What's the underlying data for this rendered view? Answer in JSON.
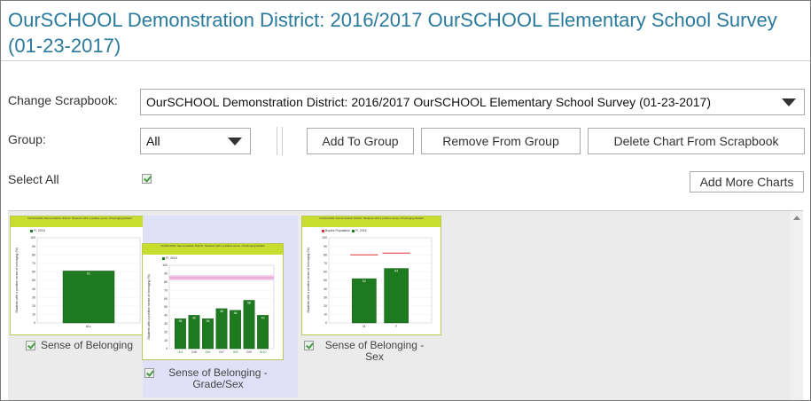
{
  "title": "OurSCHOOL Demonstration District: 2016/2017 OurSCHOOL Elementary School Survey (01-23-2017)",
  "scrapbook": {
    "label": "Change Scrapbook:",
    "selected": "OurSCHOOL Demonstration District: 2016/2017 OurSCHOOL Elementary School Survey (01-23-2017)"
  },
  "group": {
    "label": "Group:",
    "selected": "All",
    "add_label": "Add To Group",
    "remove_label": "Remove From Group",
    "delete_label": "Delete Chart From Scrapbook"
  },
  "select_all": {
    "label": "Select All",
    "checked": true
  },
  "add_more_label": "Add More Charts",
  "colors": {
    "title": "#2a7a9c",
    "bar": "#1e7a1e",
    "header": "#c9dd2f",
    "selected_bg": "#e0e0f8",
    "panel": "#ebebeb",
    "canada_line": "#e03030"
  },
  "charts": [
    {
      "label": "Sense of Belonging",
      "checked": true,
      "thumb_title": "OurSCHOOL Demonstration District: Students with a positive sense of belonging Default",
      "legend": [
        "Fi, 2016"
      ],
      "ylabel": "Students with a positive sense of belonging (%)",
      "yticks": [
        "100",
        "90",
        "80",
        "70",
        "60",
        "50",
        "40",
        "30",
        "20",
        "10",
        "0"
      ],
      "categories": [
        "ALL"
      ],
      "values": [
        61
      ],
      "value_labels": [
        "61"
      ],
      "ymax": 100
    },
    {
      "label": "Sense of Belonging - Grade/Sex",
      "checked": true,
      "selected": true,
      "thumb_title": "OurSCHOOL Demonstration District: Students with a positive sense of belonging Default",
      "legend": [
        "Fi, 2016"
      ],
      "ylabel": "Students with a positive sense of belonging (%)",
      "yticks": [
        "100",
        "90",
        "80",
        "70",
        "60",
        "50",
        "40",
        "30",
        "20",
        "10",
        "0"
      ],
      "categories": [
        "Gr4",
        "Gr5",
        "Gr6",
        "Gr7",
        "Gr8",
        "Gr9",
        "Gr10"
      ],
      "values": [
        36,
        40,
        36,
        48,
        46,
        58,
        40
      ],
      "value_labels": [
        "36",
        "40",
        "36",
        "48",
        "46",
        "58",
        "40"
      ],
      "band": [
        82,
        88
      ],
      "ymax": 100
    },
    {
      "label": "Sense of Belonging - Sex",
      "checked": true,
      "thumb_title": "OurSCHOOL Demonstration District: Students with a positive sense of belonging Default",
      "legend": [
        "Boyles Population",
        "Fi, 2016"
      ],
      "ylabel": "Students with a positive sense of belonging (%)",
      "yticks": [
        "100",
        "90",
        "80",
        "70",
        "60",
        "50",
        "40",
        "30",
        "20",
        "10",
        "0"
      ],
      "categories": [
        "M",
        "F"
      ],
      "values": [
        52,
        64
      ],
      "value_labels": [
        "52",
        "64"
      ],
      "reference": [
        80,
        82
      ],
      "ymax": 100
    }
  ]
}
